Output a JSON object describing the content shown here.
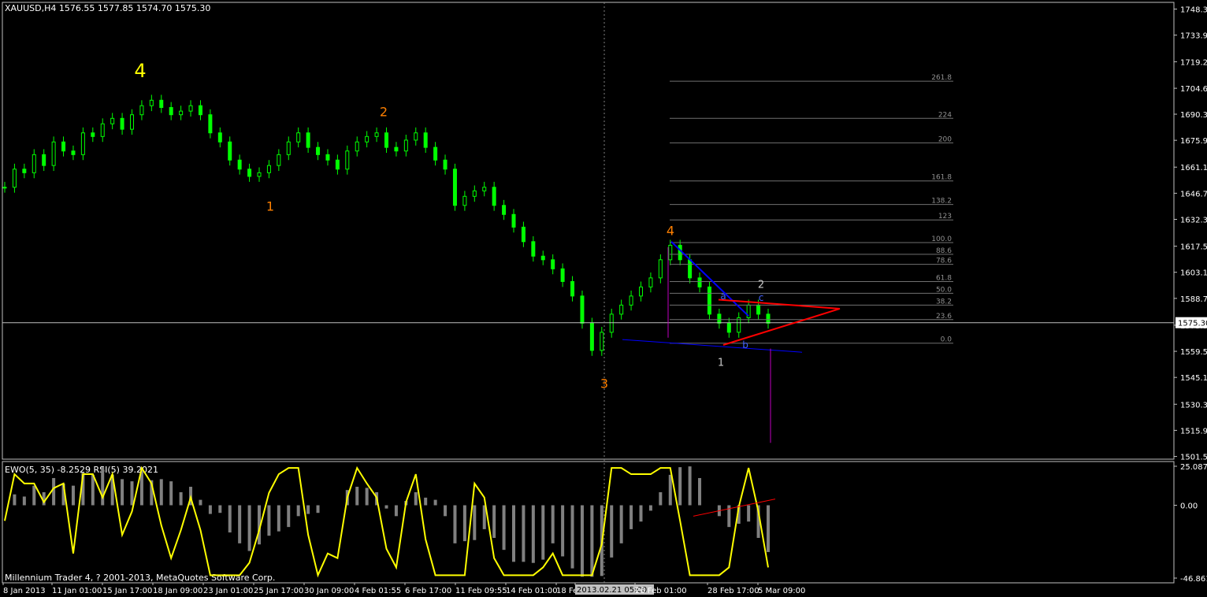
{
  "header": {
    "symbol": "XAUUSD,H4",
    "open": "1576.55",
    "high": "1577.85",
    "low": "1574.70",
    "close": "1575.30"
  },
  "indicator_header": {
    "ewo": "EWO(5, 35) -8.2529",
    "rsi": "RSI(5) 39.2021"
  },
  "copyright": "Millennium Trader 4, ? 2001-2013, MetaQuotes Software Corp.",
  "current_price_label": "1575.30",
  "crosshair_date_label": "2013.02.21 05:00",
  "colors": {
    "background": "#000000",
    "candle_bull": "#00ff00",
    "candle_bear": "#00ff00",
    "grid": "#c0c0c0",
    "wave_primary": "#ffff00",
    "wave_intermediate": "#ff8000",
    "wave_minor": "#c8c8c8",
    "fib_line": "#707070",
    "trend_blue": "#0000ff",
    "trend_red": "#ff0000",
    "ewo_hist": "#808080",
    "rsi_line": "#ffff00",
    "magenta": "#c000c0"
  },
  "chart_data": {
    "type": "line",
    "symbol": "XAUUSD",
    "timeframe": "H4",
    "price_axis_ticks": [
      "1748.30",
      "1733.95",
      "1719.25",
      "1704.60",
      "1690.30",
      "1675.90",
      "1661.10",
      "1646.70",
      "1632.30",
      "1617.50",
      "1603.10",
      "1588.70",
      "1573.90",
      "1559.50",
      "1545.10",
      "1530.30",
      "1515.90",
      "1501.50"
    ],
    "time_axis_ticks": [
      "8 Jan 2013",
      "11 Jan 01:00",
      "15 Jan 17:00",
      "18 Jan 09:00",
      "23 Jan 01:00",
      "25 Jan 17:00",
      "30 Jan 09:00",
      "4 Feb 01:55",
      "6 Feb 17:00",
      "11 Feb 09:55",
      "14 Feb 01:00",
      "18 Feb",
      "2013.02.21 05:00",
      "26 Feb 01:00",
      "28 Feb 17:00",
      "5 Mar 09:00"
    ],
    "indicator_axis_ticks": [
      "25.0876",
      "0.00",
      "-46.8619"
    ],
    "ylim": [
      1501.5,
      1752
    ],
    "series": [
      {
        "values": [
          1650,
          1660,
          1658,
          1668,
          1662,
          1675,
          1670,
          1668,
          1680,
          1678,
          1685,
          1688,
          1682,
          1690,
          1695,
          1698,
          1694,
          1690,
          1692,
          1695,
          1690,
          1680,
          1675,
          1665,
          1660,
          1656,
          1658,
          1662,
          1668,
          1675,
          1680,
          1672,
          1668,
          1665,
          1660,
          1670,
          1675,
          1678,
          1680,
          1672,
          1670,
          1676,
          1680,
          1672,
          1665,
          1660,
          1640,
          1645,
          1648,
          1650,
          1640,
          1635,
          1628,
          1620,
          1612,
          1610,
          1605,
          1598,
          1590,
          1575,
          1560,
          1570,
          1580,
          1585,
          1590,
          1595,
          1600,
          1610,
          1618,
          1610,
          1600,
          1595,
          1580,
          1575,
          1570,
          1578,
          1585,
          1580,
          1575
        ]
      }
    ],
    "wave_labels": [
      {
        "text": "4",
        "color": "yellow"
      },
      {
        "text": "1",
        "color": "orange"
      },
      {
        "text": "2",
        "color": "orange"
      },
      {
        "text": "3",
        "color": "orange"
      },
      {
        "text": "4",
        "color": "orange"
      },
      {
        "text": "1",
        "color": "white"
      },
      {
        "text": "2",
        "color": "white"
      },
      {
        "text": "a",
        "color": "blue"
      },
      {
        "text": "b",
        "color": "blue"
      },
      {
        "text": "c",
        "color": "blue"
      }
    ],
    "fib_levels": [
      "261.8",
      "224",
      "200",
      "161.8",
      "138.2",
      "123",
      "100.0",
      "88.6",
      "78.6",
      "61.8",
      "50.0",
      "38.2",
      "23.6",
      "0.0"
    ],
    "fib_prices": [
      1708.5,
      1688.0,
      1674.5,
      1653.5,
      1640.5,
      1632.0,
      1619.5,
      1613.0,
      1607.5,
      1598.0,
      1591.5,
      1585.0,
      1577.0,
      1564.0
    ]
  }
}
